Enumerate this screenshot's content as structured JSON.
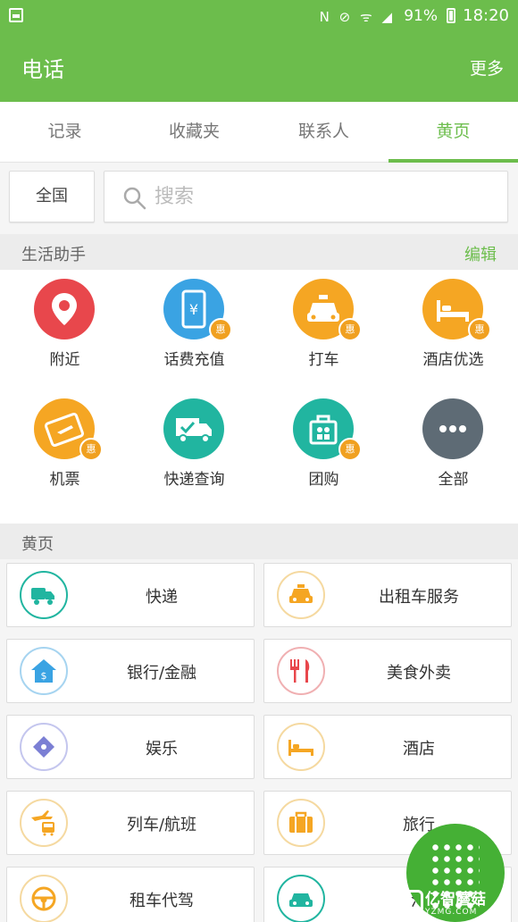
{
  "status_bar": {
    "battery": "91%",
    "time": "18:20"
  },
  "app_bar": {
    "title": "电话",
    "more_label": "更多"
  },
  "tabs": [
    {
      "label": "记录",
      "active": false
    },
    {
      "label": "收藏夹",
      "active": false
    },
    {
      "label": "联系人",
      "active": false
    },
    {
      "label": "黄页",
      "active": true
    }
  ],
  "search": {
    "region_label": "全国",
    "placeholder": "搜索"
  },
  "life_helper": {
    "header": "生活助手",
    "edit_label": "编辑",
    "items": [
      {
        "label": "附近",
        "icon": "location-pin-icon",
        "color": "#e8474c",
        "badge": ""
      },
      {
        "label": "话费充值",
        "icon": "phone-recharge-icon",
        "color": "#3aa3e3",
        "badge": "惠"
      },
      {
        "label": "打车",
        "icon": "taxi-icon",
        "color": "#f5a623",
        "badge": "惠"
      },
      {
        "label": "酒店优选",
        "icon": "hotel-bed-icon",
        "color": "#f5a623",
        "badge": "惠"
      },
      {
        "label": "机票",
        "icon": "air-ticket-icon",
        "color": "#f5a623",
        "badge": "惠"
      },
      {
        "label": "快递查询",
        "icon": "delivery-truck-icon",
        "color": "#21b5a0",
        "badge": ""
      },
      {
        "label": "团购",
        "icon": "group-buy-bag-icon",
        "color": "#21b5a0",
        "badge": "惠"
      },
      {
        "label": "全部",
        "icon": "more-dots-icon",
        "color": "#5e6b75",
        "badge": ""
      }
    ]
  },
  "yellow_pages": {
    "header": "黄页",
    "items": [
      {
        "label": "快递",
        "icon": "delivery-truck-icon",
        "color": "#21b5a0"
      },
      {
        "label": "出租车服务",
        "icon": "taxi-icon",
        "color": "#f5a623"
      },
      {
        "label": "银行/金融",
        "icon": "bank-house-icon",
        "color": "#3aa3e3"
      },
      {
        "label": "美食外卖",
        "icon": "fork-knife-icon",
        "color": "#e8474c"
      },
      {
        "label": "娱乐",
        "icon": "entertainment-ticket-icon",
        "color": "#7b7fd4"
      },
      {
        "label": "酒店",
        "icon": "hotel-bed-icon",
        "color": "#f5a623"
      },
      {
        "label": "列车/航班",
        "icon": "train-plane-icon",
        "color": "#f5a623"
      },
      {
        "label": "旅行",
        "icon": "suitcase-icon",
        "color": "#f5a623"
      },
      {
        "label": "租车代驾",
        "icon": "steering-wheel-icon",
        "color": "#f5a623"
      },
      {
        "label": "汽",
        "icon": "car-service-icon",
        "color": "#21b5a0"
      }
    ]
  },
  "watermark": {
    "main": "亿智蘑菇",
    "sub": "YZMG.COM"
  }
}
